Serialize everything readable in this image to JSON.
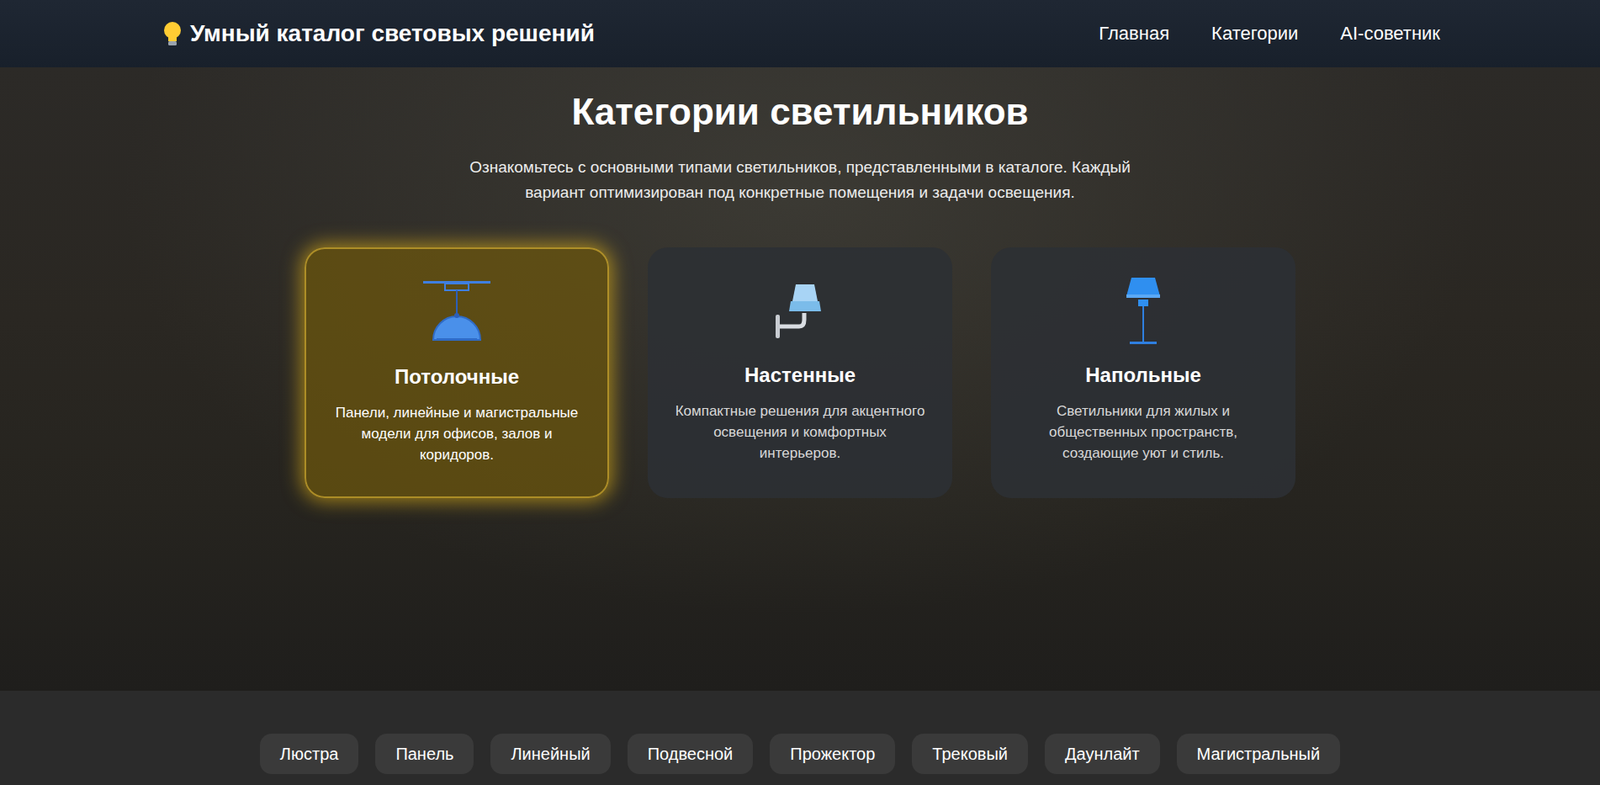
{
  "header": {
    "title": "Умный каталог световых решений",
    "nav": [
      {
        "label": "Главная",
        "selected": false
      },
      {
        "label": "Категории",
        "selected": false
      },
      {
        "label": "AI-советник",
        "selected": false
      }
    ]
  },
  "hero": {
    "title": "Категории светильников",
    "subtitle": "Ознакомьтесь с основными типами светильников, представленными в каталоге. Каждый вариант оптимизирован под конкретные помещения и задачи освещения."
  },
  "categories": [
    {
      "kind": "ceiling",
      "title": "Потолочные",
      "description": "Панели, линейные и магистральные модели для офисов, залов и коридоров.",
      "selected": true
    },
    {
      "kind": "wall",
      "title": "Настенные",
      "description": "Компактные решения для акцентного освещения и комфортных интерьеров.",
      "selected": false
    },
    {
      "kind": "floor",
      "title": "Напольные",
      "description": "Светильники для жилых и общественных пространств, создающие уют и стиль.",
      "selected": false
    }
  ],
  "filters": [
    {
      "label": "Люстра",
      "selected": false
    },
    {
      "label": "Панель",
      "selected": false
    },
    {
      "label": "Линейный",
      "selected": false
    },
    {
      "label": "Подвесной",
      "selected": false
    },
    {
      "label": "Прожектор",
      "selected": false
    },
    {
      "label": "Трековый",
      "selected": false
    },
    {
      "label": "Даунлайт",
      "selected": false
    },
    {
      "label": "Магистральный",
      "selected": false
    }
  ]
}
